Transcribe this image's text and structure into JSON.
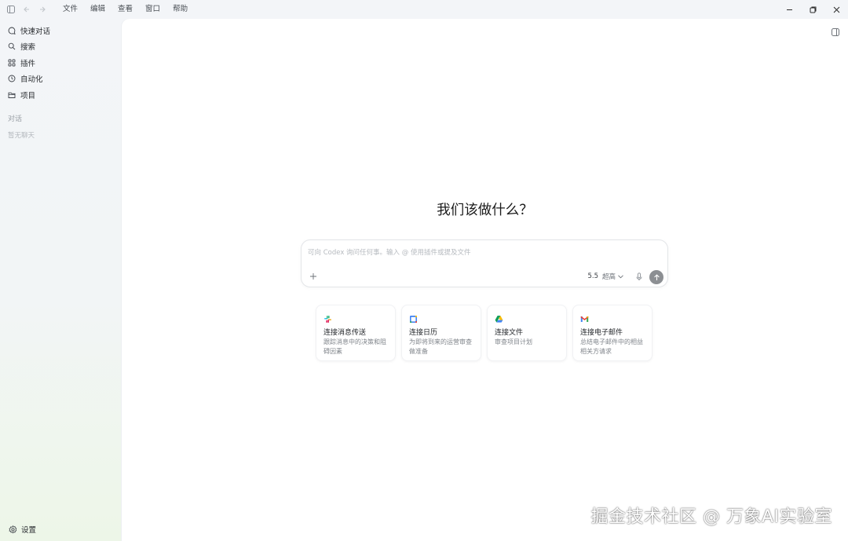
{
  "menu": [
    "文件",
    "编辑",
    "查看",
    "窗口",
    "帮助"
  ],
  "sidebar": {
    "items": [
      {
        "label": "快速对话",
        "icon": "chat-bubble-icon"
      },
      {
        "label": "搜索",
        "icon": "search-icon"
      },
      {
        "label": "插件",
        "icon": "plugins-grid-icon"
      },
      {
        "label": "自动化",
        "icon": "clock-icon"
      },
      {
        "label": "项目",
        "icon": "folder-icon"
      }
    ],
    "section_title": "对话",
    "empty_text": "暂无聊天",
    "settings_label": "设置"
  },
  "main": {
    "headline": "我们该做什么？",
    "composer": {
      "placeholder": "可向 Codex 询问任何事。输入 @ 使用插件或提及文件",
      "model": "5.5",
      "effort": "超高"
    },
    "cards": [
      {
        "title": "连接消息传送",
        "desc": "跟踪消息中的决策和阻碍因素",
        "icon": "slack-icon"
      },
      {
        "title": "连接日历",
        "desc": "为即将到来的运营审查做准备",
        "icon": "calendar-icon"
      },
      {
        "title": "连接文件",
        "desc": "审查项目计划",
        "icon": "drive-icon"
      },
      {
        "title": "连接电子邮件",
        "desc": "总结电子邮件中的相益相关方请求",
        "icon": "gmail-icon"
      }
    ]
  },
  "watermark": "掘金技术社区 @ 万象AI实验室"
}
